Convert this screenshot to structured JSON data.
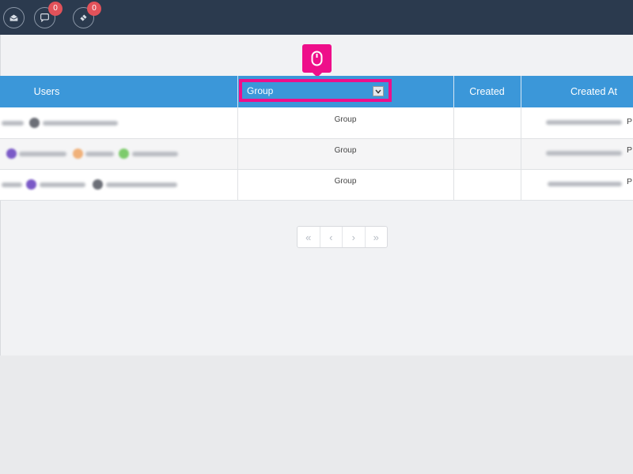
{
  "topbar": {
    "buttons": [
      {
        "icon": "envelope-open-icon"
      },
      {
        "icon": "chat-bubble-icon",
        "badge": "0"
      },
      {
        "icon": "ticket-icon",
        "badge": "0"
      }
    ]
  },
  "table": {
    "headers": {
      "users": "Users",
      "created": "Created",
      "created_at": "Created At"
    },
    "group_filter": {
      "label": "Group",
      "icon": "chevron-down-icon"
    },
    "rows": [
      {
        "group": "Group",
        "created_at_suffix": "P"
      },
      {
        "group": "Group",
        "created_at_suffix": "P"
      },
      {
        "group": "Group",
        "created_at_suffix": "P"
      }
    ]
  },
  "pagination": {
    "first": "«",
    "prev": "‹",
    "next": "›",
    "last": "»"
  },
  "colors": {
    "topbar": "#2b3a4e",
    "header": "#3b97d9",
    "highlight": "#ee0f8a",
    "badge": "#e2525a"
  }
}
